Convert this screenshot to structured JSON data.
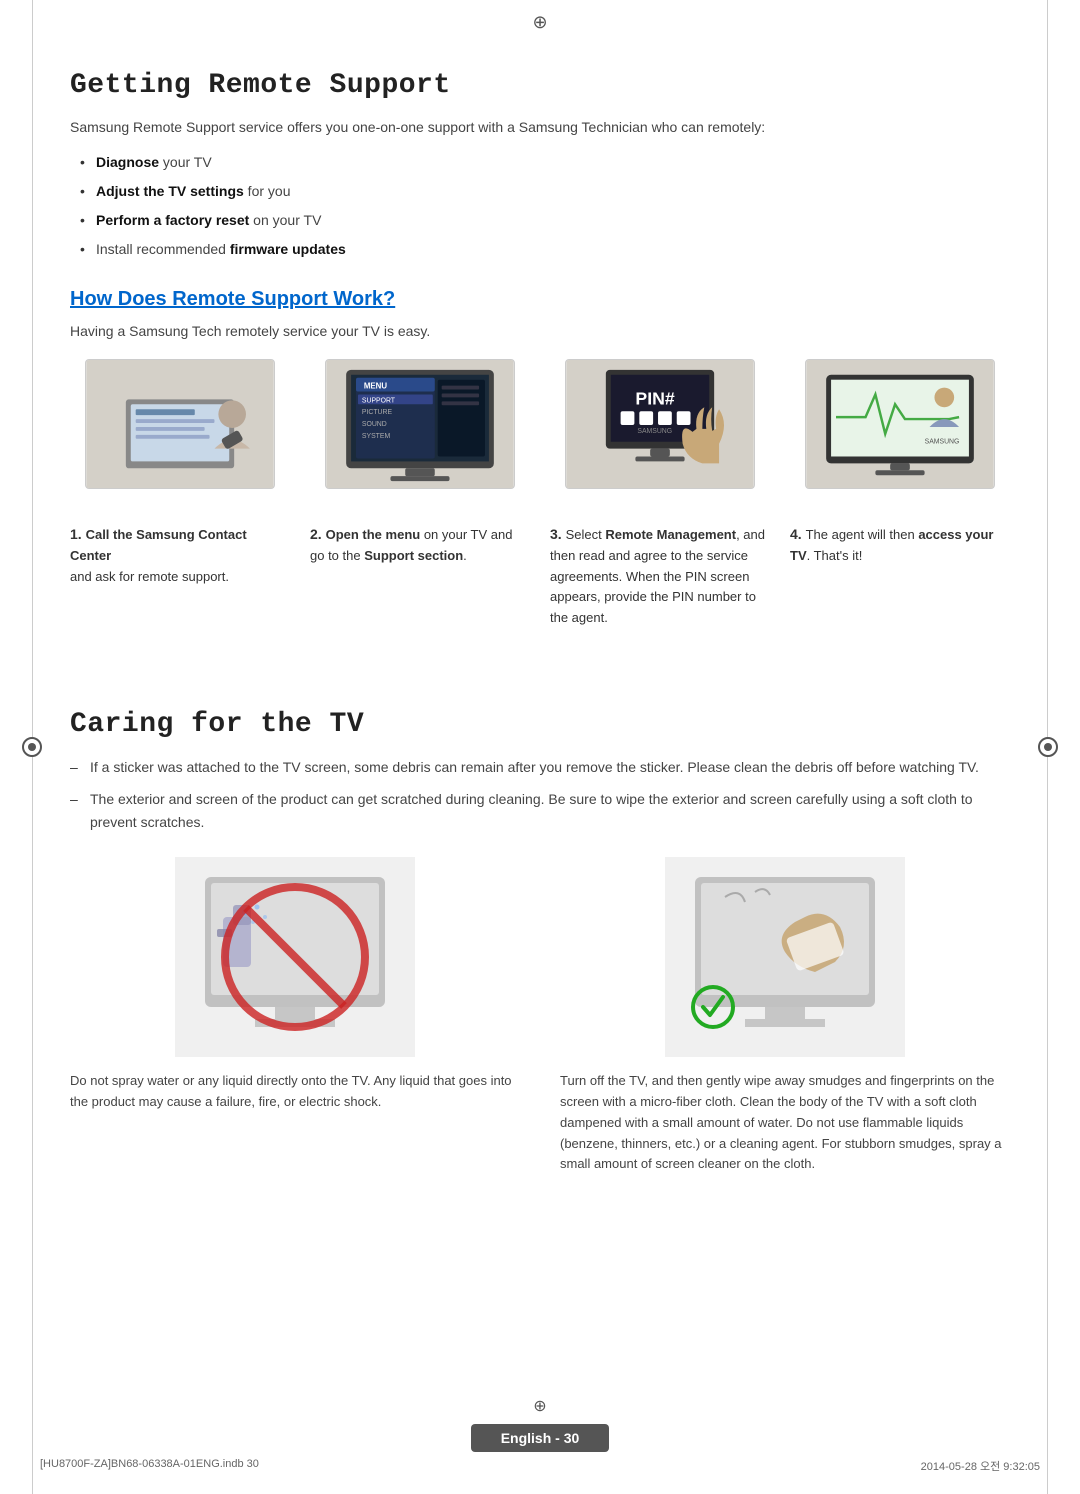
{
  "page": {
    "title": "Getting Remote Support",
    "intro": "Samsung Remote Support service offers you one-on-one support with a Samsung Technician who can remotely:",
    "bullets": [
      {
        "bold": "Diagnose",
        "rest": " your TV"
      },
      {
        "bold": "Adjust the TV settings",
        "rest": " for you"
      },
      {
        "bold": "Perform a factory reset",
        "rest": " on your TV"
      },
      {
        "bold": "",
        "rest": "Install recommended ",
        "bold2": "firmware updates"
      }
    ],
    "how_title": "How Does Remote Support Work?",
    "how_intro": "Having a Samsung Tech remotely service your TV is easy.",
    "steps": [
      {
        "num": "1.",
        "label": "Call the Samsung Contact Center",
        "detail": "and ask for remote support."
      },
      {
        "num": "2.",
        "label_pre": "Open the menu",
        "label_pre_bold": true,
        "label_rest": " on your TV and go to the ",
        "label_bold2": "Support section",
        "label_rest2": "."
      },
      {
        "num": "3.",
        "label_pre": "Select ",
        "label_bold": "Remote Management",
        "label_rest": ", and then read and agree to the service agreements. When the PIN screen appears, provide the PIN number to the agent."
      },
      {
        "num": "4.",
        "label_pre": "The agent will then ",
        "label_bold": "access your TV",
        "label_rest": ". That's it!"
      }
    ],
    "caring_title": "Caring for the TV",
    "caring_bullets": [
      "If a sticker was attached to the TV screen, some debris can remain after you remove the sticker. Please clean the debris off before watching TV.",
      "The exterior and screen of the product can get scratched during cleaning. Be sure to wipe the exterior and screen carefully using a soft cloth to prevent scratches."
    ],
    "caring_images": [
      {
        "caption": "Do not spray water or any liquid directly onto the TV. Any liquid that goes into the product may cause a failure, fire, or electric shock."
      },
      {
        "caption": "Turn off the TV, and then gently wipe away smudges and fingerprints on the screen with a micro-fiber cloth. Clean the body of the TV with a soft cloth dampened with a small amount of water. Do not use flammable liquids (benzene, thinners, etc.) or a cleaning agent. For stubborn smudges, spray a small amount of screen cleaner on the cloth."
      }
    ],
    "footer": {
      "badge": "English - 30",
      "meta_left": "[HU8700F-ZA]BN68-06338A-01ENG.indb  30",
      "meta_right": "2014-05-28   오전 9:32:05"
    }
  }
}
